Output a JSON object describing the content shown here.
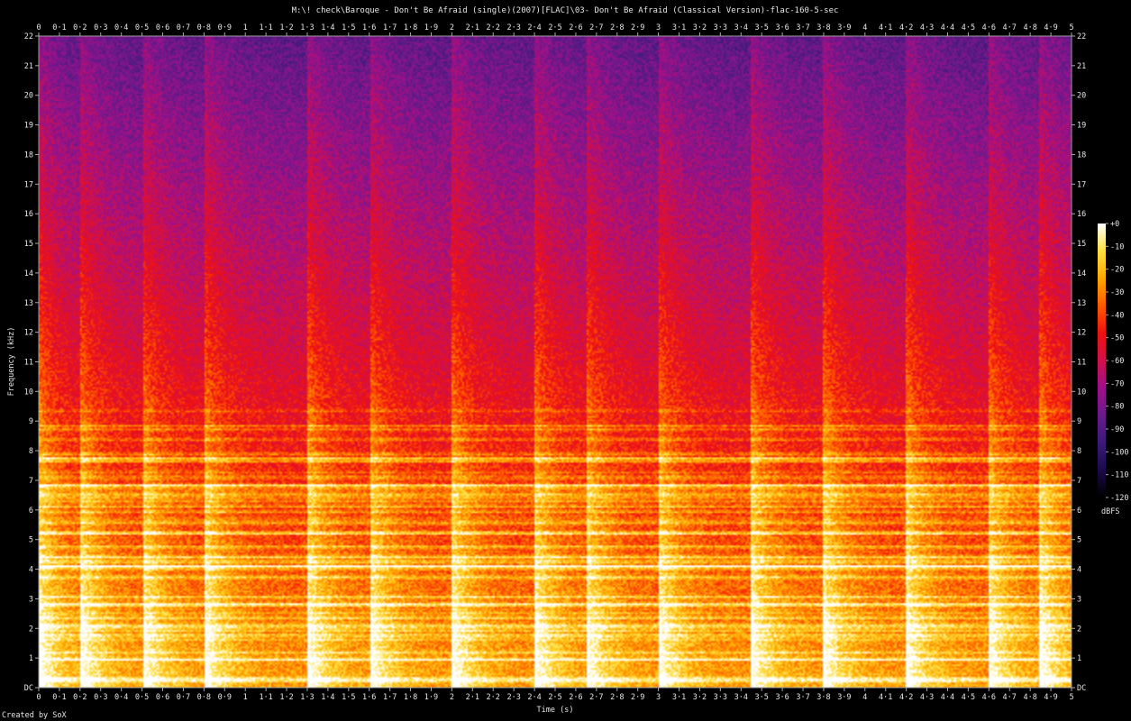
{
  "chart_data": {
    "type": "heatmap",
    "title": "M:\\! check\\Baroque - Don't Be Afraid (single)(2007)[FLAC]\\03- Don't Be Afraid (Classical Version)-flac-160-5-sec",
    "xlabel": "Time (s)",
    "ylabel": "Frequency (kHz)",
    "xlim": [
      0,
      5
    ],
    "ylim": [
      0,
      22
    ],
    "x_ticks": [
      "0",
      "0·1",
      "0·2",
      "0·3",
      "0·4",
      "0·5",
      "0·6",
      "0·7",
      "0·8",
      "0·9",
      "1",
      "1·1",
      "1·2",
      "1·3",
      "1·4",
      "1·5",
      "1·6",
      "1·7",
      "1·8",
      "1·9",
      "2",
      "2·1",
      "2·2",
      "2·3",
      "2·4",
      "2·5",
      "2·6",
      "2·7",
      "2·8",
      "2·9",
      "3",
      "3·1",
      "3·2",
      "3·3",
      "3·4",
      "3·5",
      "3·6",
      "3·7",
      "3·8",
      "3·9",
      "4",
      "4·1",
      "4·2",
      "4·3",
      "4·4",
      "4·5",
      "4·6",
      "4·7",
      "4·8",
      "4·9",
      "5"
    ],
    "y_ticks": [
      "DC",
      "1",
      "2",
      "3",
      "4",
      "5",
      "6",
      "7",
      "8",
      "9",
      "10",
      "11",
      "12",
      "13",
      "14",
      "15",
      "16",
      "17",
      "18",
      "19",
      "20",
      "21",
      "22"
    ],
    "colorbar": {
      "label": "dBFS",
      "ticks": [
        "+0",
        "-10",
        "-20",
        "-30",
        "-40",
        "-50",
        "-60",
        "-70",
        "-80",
        "-90",
        "-100",
        "-110",
        "-120"
      ],
      "range_db": [
        -120,
        0
      ],
      "colors": [
        "#000000",
        "#1a0a4a",
        "#3b1a7a",
        "#6a1a8a",
        "#a0108a",
        "#d0104a",
        "#f01010",
        "#ff5a00",
        "#ffa800",
        "#ffe040",
        "#ffffff"
      ]
    },
    "onsets_s": [
      0.0,
      0.2,
      0.5,
      0.8,
      1.3,
      1.6,
      2.0,
      2.4,
      2.65,
      3.0,
      3.45,
      3.8,
      4.2,
      4.6,
      4.85
    ]
  },
  "footer": "Created by SoX"
}
